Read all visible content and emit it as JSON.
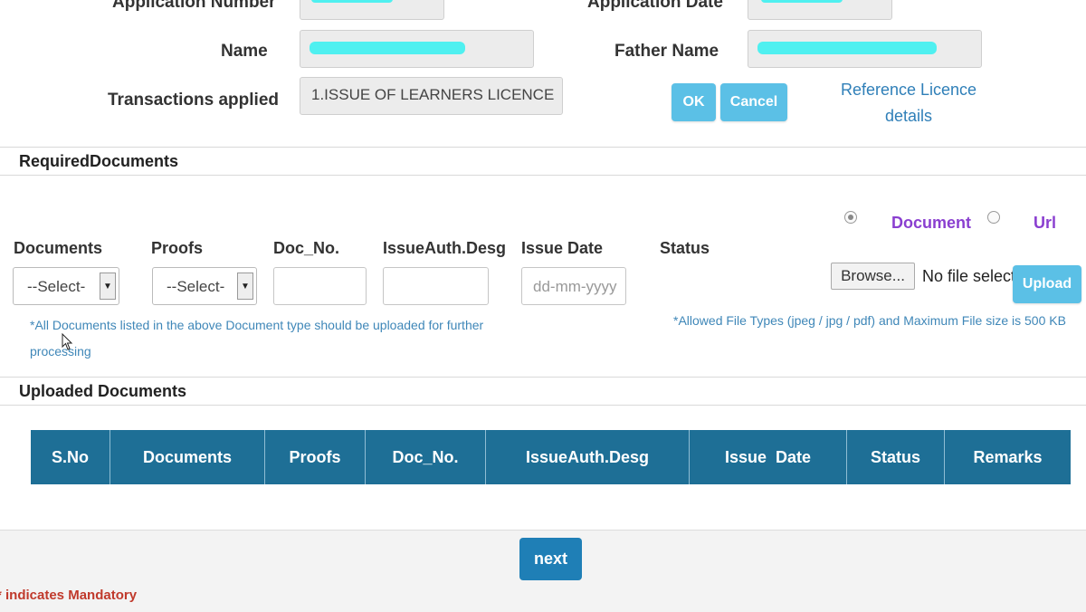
{
  "applicant": {
    "application_number_label": "Application Number",
    "application_date_label": "Application Date",
    "name_label": "Name",
    "father_name_label": "Father Name",
    "transactions_label": "Transactions applied",
    "transactions_value": "1.ISSUE OF LEARNERS LICENCE"
  },
  "actions": {
    "ok_label": "OK",
    "cancel_label": "Cancel",
    "reference_link_line1": "Reference Licence",
    "reference_link_line2": "details"
  },
  "required_documents": {
    "heading": "RequiredDocuments",
    "upload_mode_document": "Document",
    "upload_mode_url": "Url",
    "selected_mode": "Document",
    "columns": {
      "documents": "Documents",
      "proofs": "Proofs",
      "doc_no": "Doc_No.",
      "issue_auth": "IssueAuth.Desg",
      "issue_date": "Issue Date",
      "status": "Status"
    },
    "documents_select_value": "--Select-",
    "proofs_select_value": "--Select-",
    "issue_date_placeholder": "dd-mm-yyyy",
    "browse_label": "Browse...",
    "file_status": "No file selected.",
    "upload_label": "Upload",
    "note_left": "*All Documents listed in the above Document type should be uploaded for further processing",
    "note_right": "*Allowed File Types (jpeg / jpg / pdf) and Maximum File size is 500 KB"
  },
  "uploaded_documents": {
    "heading": "Uploaded Documents",
    "columns": [
      "S.No",
      "Documents",
      "Proofs",
      "Doc_No.",
      "IssueAuth.Desg",
      "Issue  Date",
      "Status",
      "Remarks"
    ]
  },
  "footer": {
    "next_label": "next",
    "mandatory_note": "* indicates Mandatory"
  },
  "colors": {
    "accent": "#5bc0e6",
    "table_header": "#1e6f96",
    "link": "#2f7fb8",
    "mandatory": "#c0392b",
    "radio_label": "#8a3fd0"
  }
}
